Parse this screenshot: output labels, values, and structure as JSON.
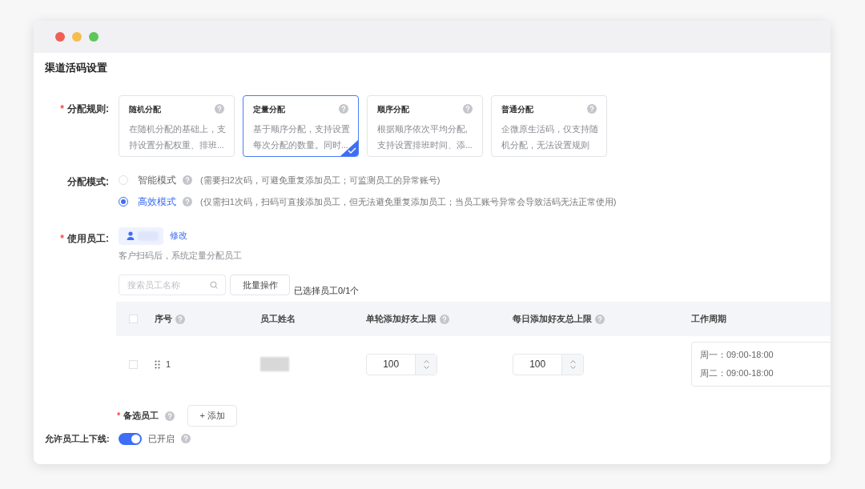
{
  "page_title": "渠道活码设置",
  "rule": {
    "label": "分配规则:",
    "required_mark": "*",
    "options": [
      {
        "title": "随机分配",
        "lines": [
          "在随机分配的基础上，支",
          "持设置分配权重、排班..."
        ],
        "selected": false
      },
      {
        "title": "定量分配",
        "lines": [
          "基于顺序分配，支持设置",
          "每次分配的数量。同时..."
        ],
        "selected": true
      },
      {
        "title": "顺序分配",
        "lines": [
          "根据顺序依次平均分配,",
          "支持设置排班时间、添..."
        ],
        "selected": false
      },
      {
        "title": "普通分配",
        "lines": [
          "企微原生活码，仅支持随",
          "机分配，无法设置规则"
        ],
        "selected": false
      }
    ]
  },
  "mode": {
    "label": "分配模式:",
    "options": [
      {
        "label": "智能模式",
        "note": "(需要扫2次码，可避免重复添加员工；可监测员工的异常账号)",
        "selected": false
      },
      {
        "label": "高效模式",
        "note": "(仅需扫1次码，扫码可直接添加员工，但无法避免重复添加员工；当员工账号异常会导致活码无法正常使用)",
        "selected": true
      }
    ]
  },
  "staff": {
    "label": "使用员工:",
    "required_mark": "*",
    "edit_link": "修改",
    "hint": "客户扫码后，系统定量分配员工",
    "search_placeholder": "搜索员工名称",
    "batch_button": "批量操作",
    "selected_count": "已选择员工0/1个"
  },
  "table": {
    "all_checked": false,
    "columns": [
      {
        "label": "序号",
        "help": true
      },
      {
        "label": "员工姓名",
        "help": false
      },
      {
        "label": "单轮添加好友上限",
        "help": true
      },
      {
        "label": "每日添加好友总上限",
        "help": true
      },
      {
        "label": "工作周期",
        "help": false
      }
    ],
    "rows": [
      {
        "checked": false,
        "index": "1",
        "round_limit": "100",
        "daily_limit": "100",
        "schedule": [
          "周一：09:00-18:00",
          "周二：09:00-18:00"
        ]
      }
    ]
  },
  "backup": {
    "label": "备选员工",
    "required_mark": "*",
    "add_button": "+ 添加"
  },
  "online": {
    "label": "允许员工上下线:",
    "on": true,
    "status": "已开启"
  }
}
